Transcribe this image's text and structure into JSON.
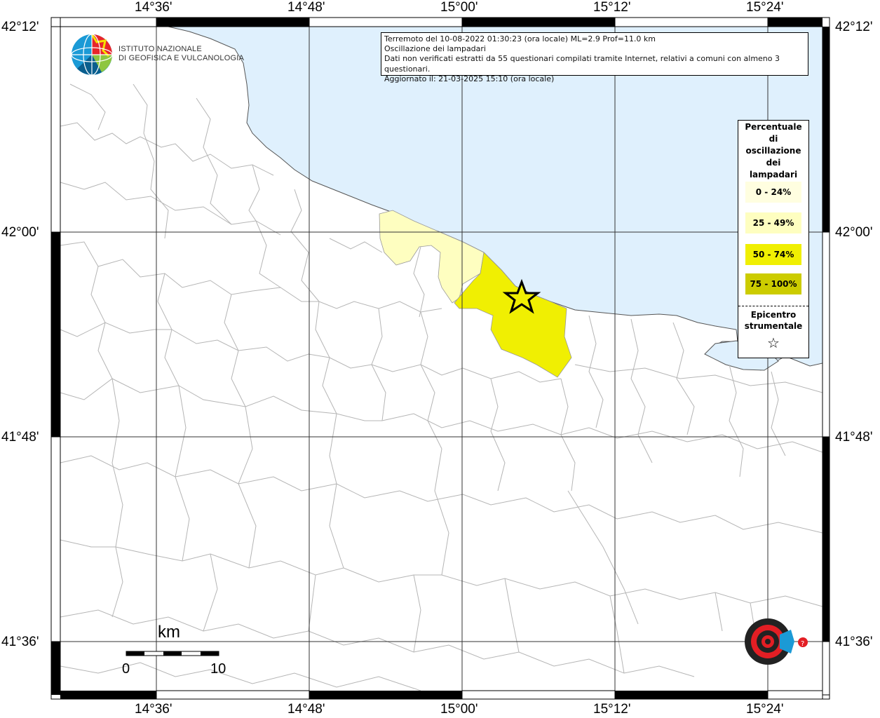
{
  "header": {
    "line1": "Terremoto del 10-08-2022 01:30:23 (ora locale) ML=2.9 Prof=11.0 km",
    "line2": "Oscillazione dei lampadari",
    "line3": "Dati non verificati estratti da 55 questionari compilati tramite Internet, relativi a comuni con almeno 3 questionari.",
    "line4": "Aggiornato il: 21-03-2025 15:10 (ora locale)"
  },
  "logo": {
    "line1": "ISTITUTO NAZIONALE",
    "line2": "DI GEOFISICA E VULCANOLOGIA",
    "icon": "ingv-globe-logo"
  },
  "legend": {
    "title": [
      "Percentuale",
      "di",
      "oscillazione",
      "dei",
      "lampadari"
    ],
    "classes": [
      {
        "label": "0 - 24%",
        "color": "#fffee0"
      },
      {
        "label": "25 - 49%",
        "color": "#fefec0"
      },
      {
        "label": "50 - 74%",
        "color": "#f0ef02"
      },
      {
        "label": "75 - 100%",
        "color": "#cccc00"
      }
    ],
    "epicenter_title": [
      "Epicentro",
      "strumentale"
    ],
    "epicenter_icon": "star-icon"
  },
  "axes": {
    "longitude_ticks": [
      "14°36'",
      "14°48'",
      "15°00'",
      "15°12'",
      "15°24'"
    ],
    "latitude_ticks": [
      "42°12'",
      "42°00'",
      "41°48'",
      "41°36'"
    ]
  },
  "scale_bar": {
    "unit": "km",
    "start": "0",
    "end": "10"
  },
  "colors": {
    "sea": "#dff0fd",
    "land": "#ffffff",
    "boundaries": "#b5b5b5",
    "grid": "#333333"
  },
  "stamp": {
    "icon": "haisentitoilterremoto-logo"
  }
}
